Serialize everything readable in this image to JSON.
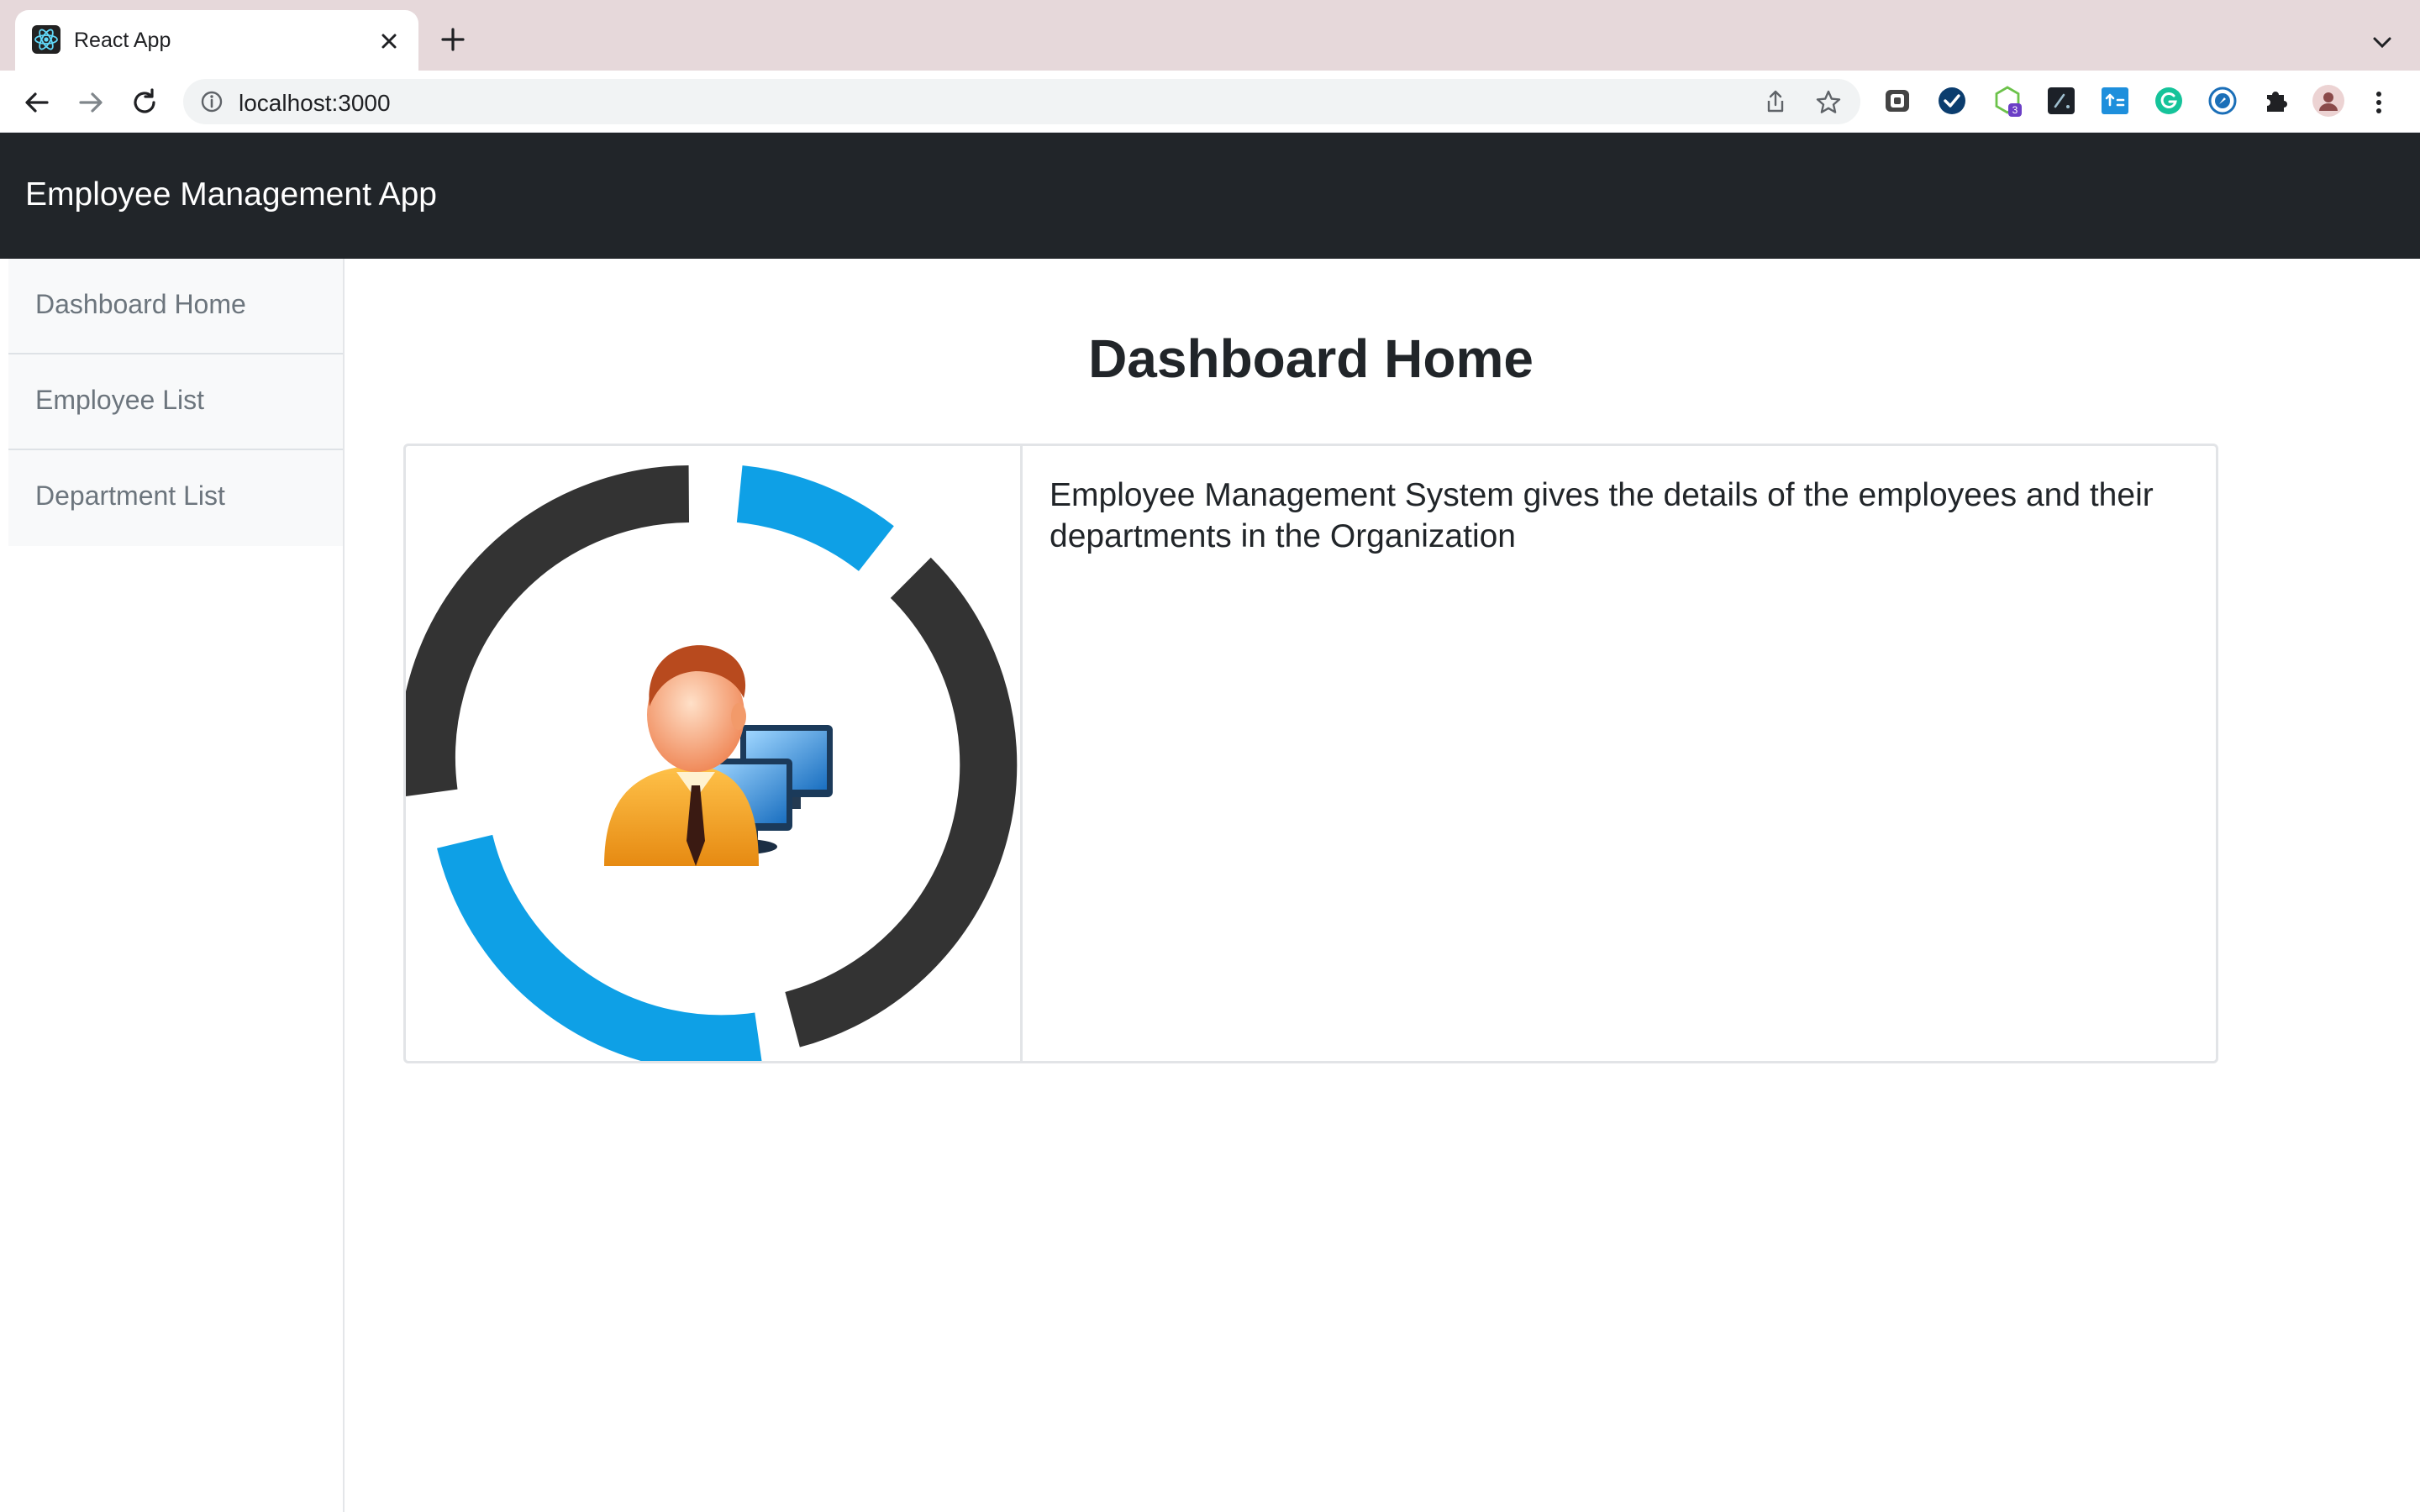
{
  "browser": {
    "tab_title": "React App",
    "url": "localhost:3000",
    "extension_badge": "3"
  },
  "navbar": {
    "brand": "Employee Management App"
  },
  "sidebar": {
    "items": [
      {
        "label": "Dashboard Home"
      },
      {
        "label": "Employee List"
      },
      {
        "label": "Department List"
      }
    ]
  },
  "main": {
    "title": "Dashboard Home",
    "card_text": "Employee Management System gives the details of the employees and their departments in the Organization"
  },
  "colors": {
    "navbar_bg": "#212529",
    "ring_dark": "#333333",
    "ring_blue": "#0ea0e6"
  }
}
